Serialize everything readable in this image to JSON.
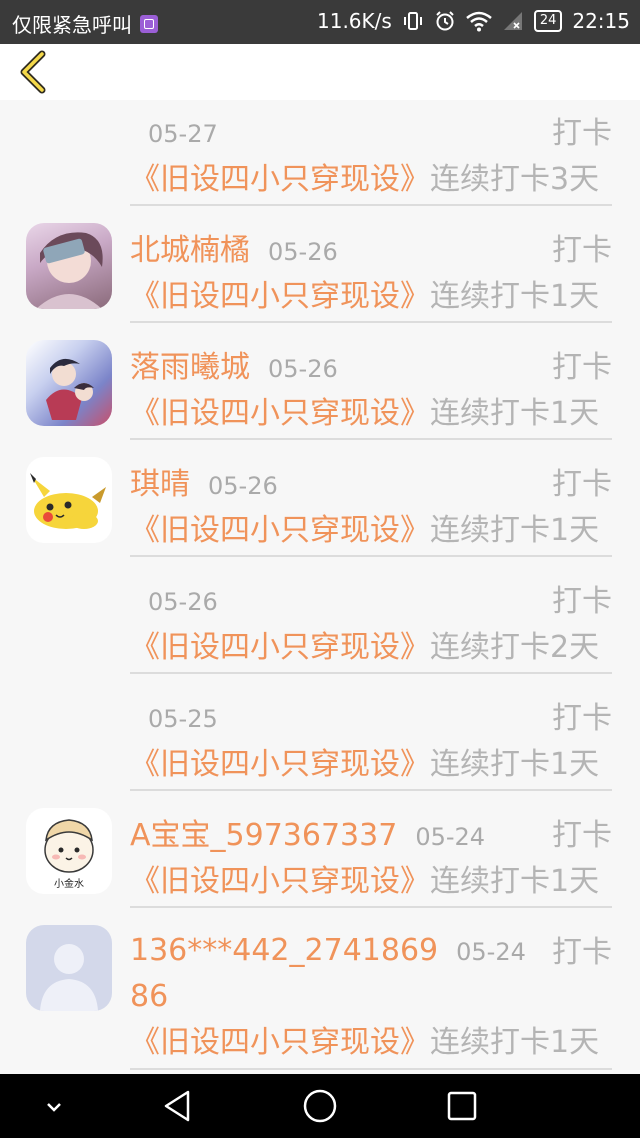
{
  "status_bar": {
    "carrier": "仅限紧急呼叫",
    "network_speed": "11.6K/s",
    "battery": "24",
    "time": "22:15"
  },
  "header": {
    "back_icon": "chevron-left-icon"
  },
  "accent_color": "#f0935a",
  "list": [
    {
      "name": "",
      "date": "05-27",
      "action": "打卡",
      "book": "《旧设四小只穿现设》",
      "streak": "连续打卡3天",
      "avatar": "none"
    },
    {
      "name": "北城楠橘",
      "date": "05-26",
      "action": "打卡",
      "book": "《旧设四小只穿现设》",
      "streak": "连续打卡1天",
      "avatar": "anime-girl"
    },
    {
      "name": "落雨曦城",
      "date": "05-26",
      "action": "打卡",
      "book": "《旧设四小只穿现设》",
      "streak": "连续打卡1天",
      "avatar": "anime-couple"
    },
    {
      "name": "琪晴",
      "date": "05-26",
      "action": "打卡",
      "book": "《旧设四小只穿现设》",
      "streak": "连续打卡1天",
      "avatar": "pikachu"
    },
    {
      "name": "",
      "date": "05-26",
      "action": "打卡",
      "book": "《旧设四小只穿现设》",
      "streak": "连续打卡2天",
      "avatar": "none"
    },
    {
      "name": "",
      "date": "05-25",
      "action": "打卡",
      "book": "《旧设四小只穿现设》",
      "streak": "连续打卡1天",
      "avatar": "none"
    },
    {
      "name": "A宝宝_597367337",
      "date": "05-24",
      "action": "打卡",
      "book": "《旧设四小只穿现设》",
      "streak": "连续打卡1天",
      "avatar": "cartoon-kid",
      "avatar_caption": "小金水"
    },
    {
      "name": "136***442_274186986",
      "name_line1": "136***442_2741869",
      "name_line2": "86",
      "date": "05-24",
      "action": "打卡",
      "book": "《旧设四小只穿现设》",
      "streak": "连续打卡1天",
      "avatar": "default-user"
    }
  ]
}
